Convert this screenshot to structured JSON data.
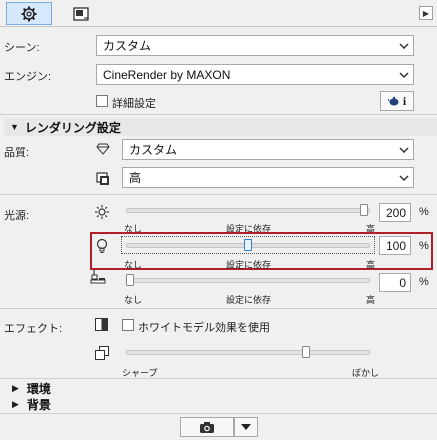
{
  "tabs": [
    {
      "icon": "gear-icon",
      "active": true
    },
    {
      "icon": "render-window-icon",
      "active": false
    }
  ],
  "scene": {
    "label": "シーン:",
    "value": "カスタム"
  },
  "engine": {
    "label": "エンジン:",
    "value": "CineRender by MAXON"
  },
  "detail": {
    "label": "詳細設定",
    "checked": false
  },
  "info_button_label": "i",
  "rendering_section": {
    "title": "レンダリング設定"
  },
  "quality": {
    "label": "品質:",
    "preset": "カスタム",
    "level": "高"
  },
  "light": {
    "label": "光源:",
    "sun": {
      "value": "200",
      "unit": "%",
      "min_label": "なし",
      "mid_label": "設定に依存",
      "max_label": "高",
      "level_percent": 200
    },
    "bulb": {
      "value": "100",
      "unit": "%",
      "min_label": "なし",
      "mid_label": "設定に依存",
      "max_label": "高",
      "level_percent": 100
    },
    "lamp": {
      "value": "0",
      "unit": "%",
      "min_label": "なし",
      "mid_label": "設定に依存",
      "max_label": "高",
      "level_percent": 0
    }
  },
  "effects": {
    "label": "エフェクト:",
    "white_model_label": "ホワイトモデル効果を使用",
    "white_model_checked": false,
    "sharp_label": "シャープ",
    "blur_label": "ぼかし",
    "blur_level_fraction": 0.72
  },
  "environment_section": {
    "title": "環境"
  },
  "background_section": {
    "title": "背景"
  },
  "colors": {
    "highlight": "#b0202a",
    "tab_active": "#d6e8fb"
  }
}
